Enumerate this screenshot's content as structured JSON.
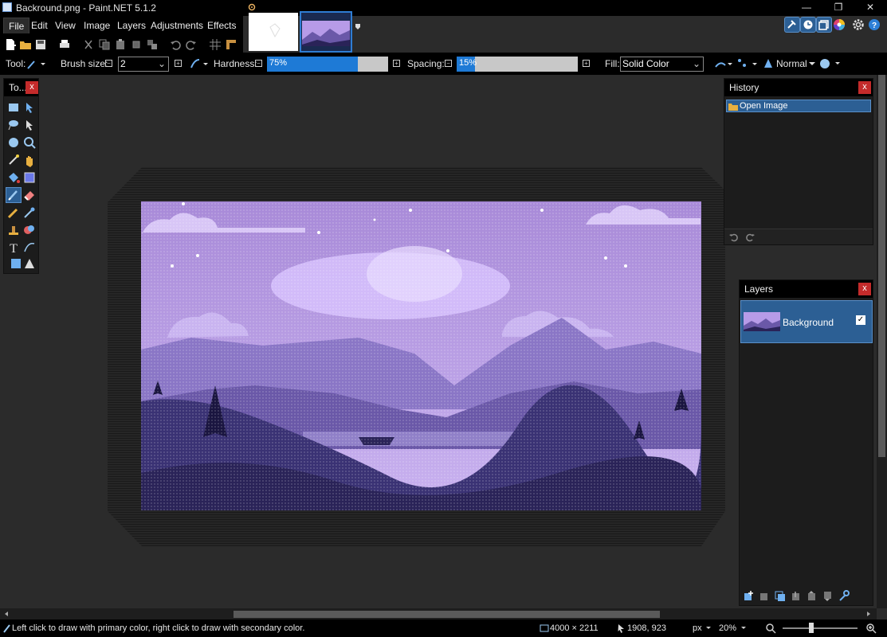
{
  "window": {
    "title": "Backround.png - Paint.NET 5.1.2",
    "minimize": "—",
    "restore": "❐",
    "close": "✕"
  },
  "menu": [
    "File",
    "Edit",
    "View",
    "Image",
    "Layers",
    "Adjustments",
    "Effects"
  ],
  "toolbar": {
    "tool_label": "Tool:",
    "brush_size_label": "Brush size:",
    "brush_size_value": "2",
    "hardness_label": "Hardness:",
    "hardness_value": "75%",
    "hardness_fraction": 0.75,
    "spacing_label": "Spacing:",
    "spacing_value": "15%",
    "spacing_fraction": 0.15,
    "fill_label": "Fill:",
    "fill_value": "Solid Color",
    "blend_mode": "Normal"
  },
  "tools_panel": {
    "title": "To...",
    "close": "x"
  },
  "history": {
    "title": "History",
    "close": "x",
    "items": [
      "Open Image"
    ]
  },
  "layers": {
    "title": "Layers",
    "close": "x",
    "items": [
      {
        "name": "Background",
        "visible": "✓"
      }
    ]
  },
  "status": {
    "hint": "Left click to draw with primary color, right click to draw with secondary color.",
    "image_size": "4000 × 2211",
    "cursor_pos": "1908, 923",
    "units": "px",
    "zoom": "20%"
  },
  "colors": {
    "accent": "#2c5f94",
    "accent_border": "#5a8fc8",
    "slider_fill": "#1e7ad6",
    "close_red": "#c42b2b",
    "image_sky": "#b79be8",
    "image_deep": "#2a2358"
  }
}
